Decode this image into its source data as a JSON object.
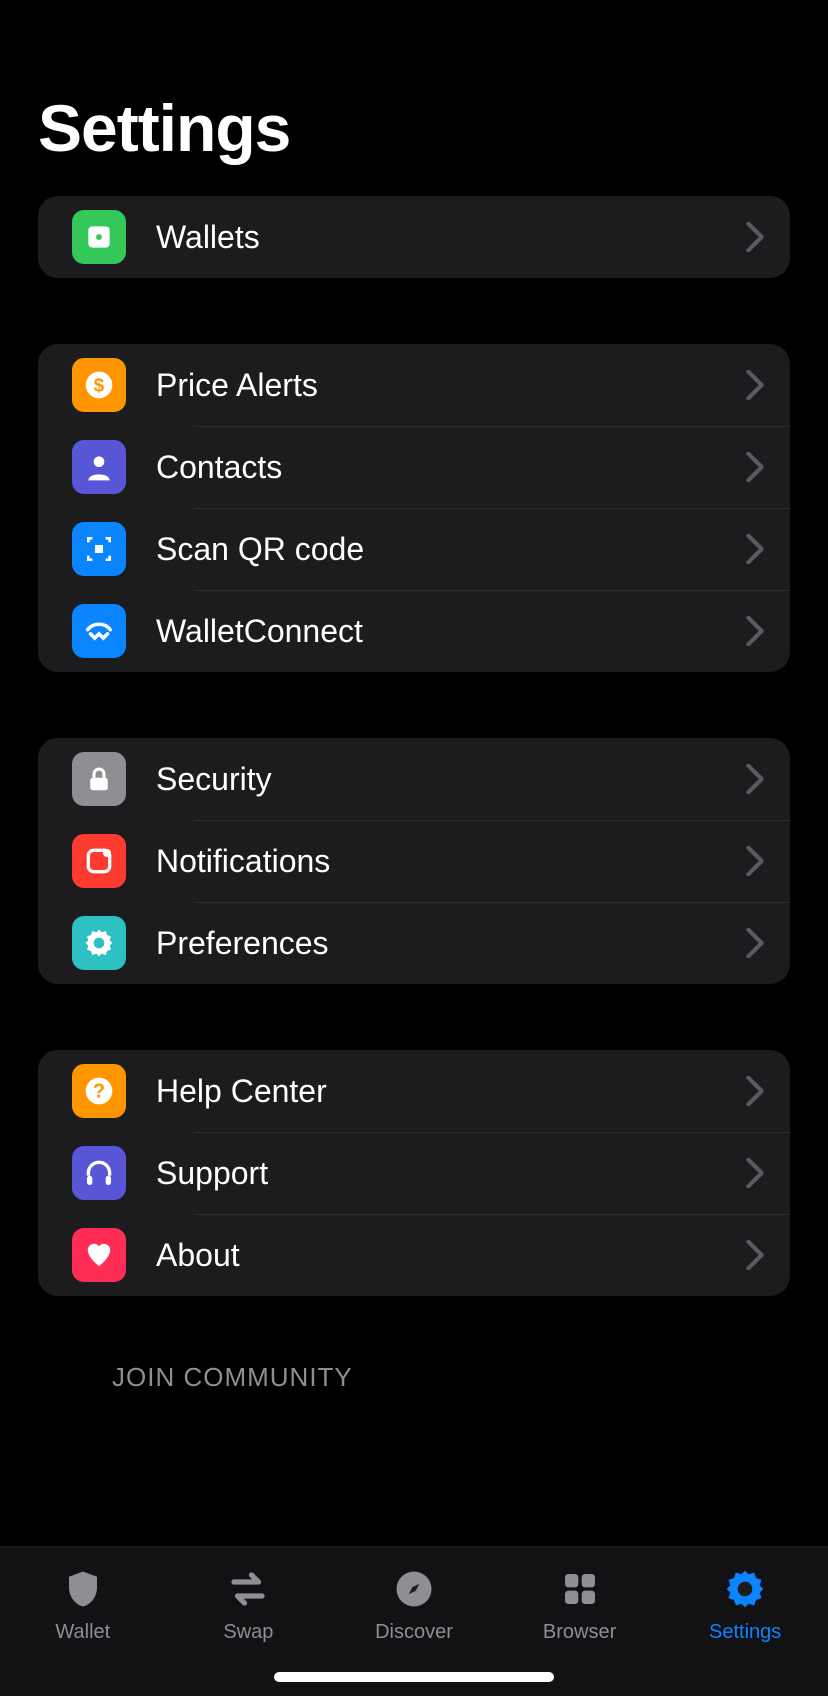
{
  "title": "Settings",
  "groups": [
    {
      "rows": [
        {
          "icon": "wallet-icon",
          "bg": "bg-green",
          "label": "Wallets"
        }
      ]
    },
    {
      "rows": [
        {
          "icon": "dollar-icon",
          "bg": "bg-orange",
          "label": "Price Alerts"
        },
        {
          "icon": "person-icon",
          "bg": "bg-indigo",
          "label": "Contacts"
        },
        {
          "icon": "qr-icon",
          "bg": "bg-blue",
          "label": "Scan QR code"
        },
        {
          "icon": "walletconnect-icon",
          "bg": "bg-blue",
          "label": "WalletConnect"
        }
      ]
    },
    {
      "rows": [
        {
          "icon": "lock-icon",
          "bg": "bg-gray",
          "label": "Security"
        },
        {
          "icon": "bell-icon",
          "bg": "bg-red",
          "label": "Notifications"
        },
        {
          "icon": "gear-icon",
          "bg": "bg-teal",
          "label": "Preferences"
        }
      ]
    },
    {
      "rows": [
        {
          "icon": "help-icon",
          "bg": "bg-orange",
          "label": "Help Center"
        },
        {
          "icon": "headphones-icon",
          "bg": "bg-indigo",
          "label": "Support"
        },
        {
          "icon": "heart-icon",
          "bg": "bg-pink",
          "label": "About"
        }
      ]
    }
  ],
  "community_header": "JOIN COMMUNITY",
  "nav": [
    {
      "icon": "shield-icon",
      "label": "Wallet",
      "active": false
    },
    {
      "icon": "swap-icon",
      "label": "Swap",
      "active": false
    },
    {
      "icon": "compass-icon",
      "label": "Discover",
      "active": false
    },
    {
      "icon": "grid-icon",
      "label": "Browser",
      "active": false
    },
    {
      "icon": "gear-icon",
      "label": "Settings",
      "active": true
    }
  ]
}
